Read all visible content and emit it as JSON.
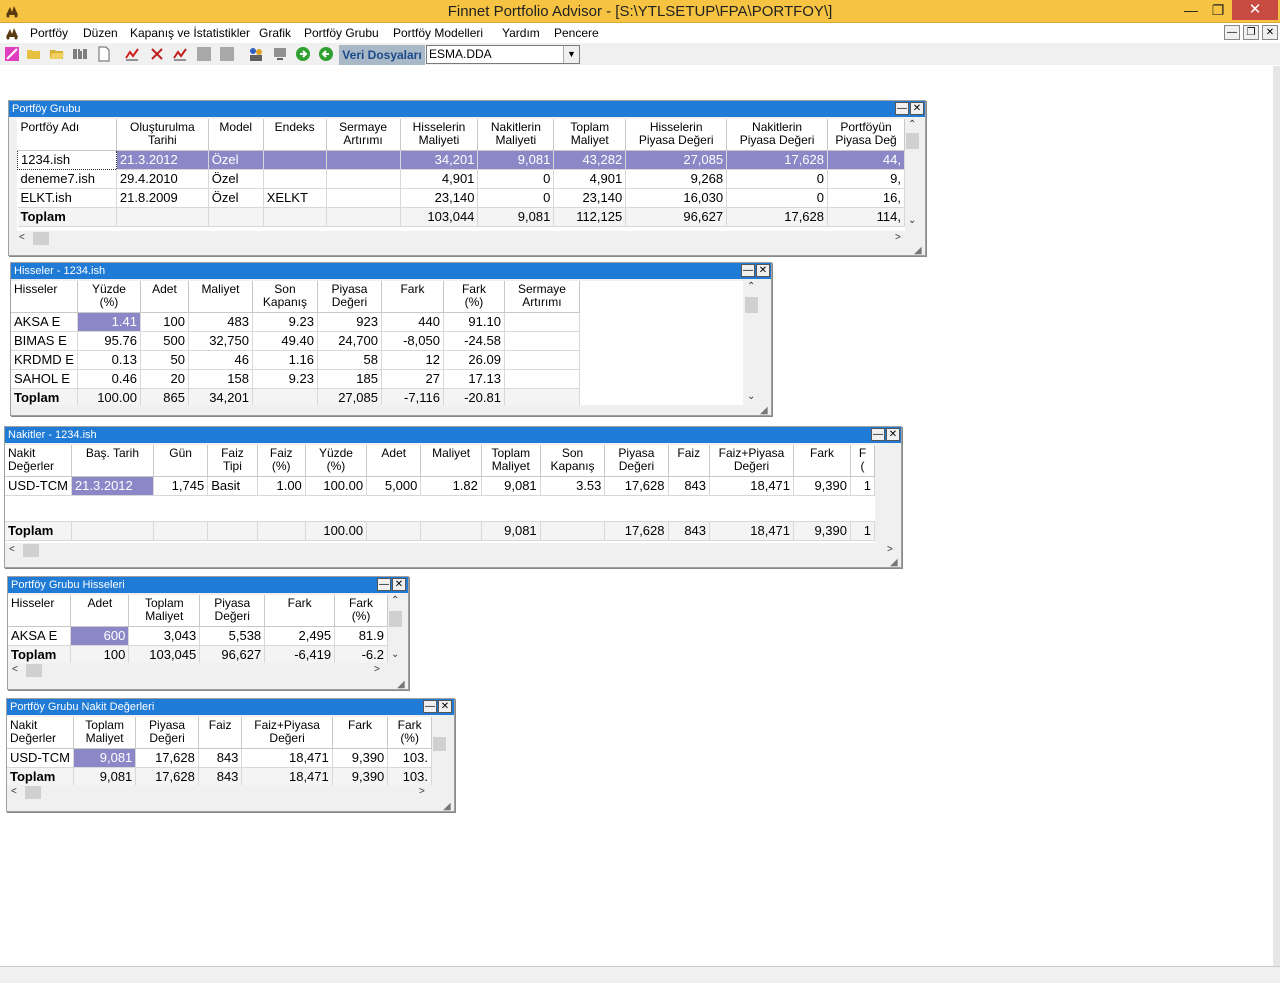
{
  "app": {
    "title": "Finnet Portfolio Advisor - [S:\\YTLSETUP\\FPA\\PORTFOY\\]"
  },
  "menu": [
    "Portföy",
    "Düzen",
    "Kapanış ve İstatistikler",
    "Grafik",
    "Portföy Grubu",
    "Portföy Modelleri",
    "Yardım",
    "Pencere"
  ],
  "toolbar": {
    "veri_label": "Veri Dosyaları",
    "file_value": "ESMA.DDA"
  },
  "portfoy_grubu": {
    "title": "Portföy Grubu",
    "headers": [
      "Portföy Adı",
      "Oluşturulma\nTarihi",
      "Model",
      "Endeks",
      "Sermaye\nArtırımı",
      "Hisselerin\nMaliyeti",
      "Nakitlerin\nMaliyeti",
      "Toplam\nMaliyet",
      "Hisselerin\nPiyasa Değeri",
      "Nakitlerin\nPiyasa Değeri",
      "Portföyün\nPiyasa Değ"
    ],
    "rows": [
      [
        "1234.ish",
        "21.3.2012",
        "Özel",
        "",
        "",
        "34,201",
        "9,081",
        "43,282",
        "27,085",
        "17,628",
        "44,"
      ],
      [
        "deneme7.ish",
        "29.4.2010",
        "Özel",
        "",
        "",
        "4,901",
        "0",
        "4,901",
        "9,268",
        "0",
        "9,"
      ],
      [
        "ELKT.ish",
        "21.8.2009",
        "Özel",
        "XELKT",
        "",
        "23,140",
        "0",
        "23,140",
        "16,030",
        "0",
        "16,"
      ]
    ],
    "total": [
      "Toplam",
      "",
      "",
      "",
      "",
      "103,044",
      "9,081",
      "112,125",
      "96,627",
      "17,628",
      "114,"
    ]
  },
  "hisseler": {
    "title": "Hisseler - 1234.ish",
    "headers": [
      "Hisseler",
      "Yüzde\n(%)",
      "Adet",
      "Maliyet",
      "Son\nKapanış",
      "Piyasa\nDeğeri",
      "Fark",
      "Fark\n(%)",
      "Sermaye\nArtırımı"
    ],
    "rows": [
      [
        "AKSA  E",
        "1.41",
        "100",
        "483",
        "9.23",
        "923",
        "440",
        "91.10",
        ""
      ],
      [
        "BIMAS E",
        "95.76",
        "500",
        "32,750",
        "49.40",
        "24,700",
        "-8,050",
        "-24.58",
        ""
      ],
      [
        "KRDMD E",
        "0.13",
        "50",
        "46",
        "1.16",
        "58",
        "12",
        "26.09",
        ""
      ],
      [
        "SAHOL E",
        "0.46",
        "20",
        "158",
        "9.23",
        "185",
        "27",
        "17.13",
        ""
      ]
    ],
    "total": [
      "Toplam",
      "100.00",
      "865",
      "34,201",
      "",
      "27,085",
      "-7,116",
      "-20.81",
      ""
    ]
  },
  "nakitler": {
    "title": "Nakitler - 1234.ish",
    "headers": [
      "Nakit\nDeğerler",
      "Baş. Tarih",
      "Gün",
      "Faiz\nTipi",
      "Faiz\n(%)",
      "Yüzde\n(%)",
      "Adet",
      "Maliyet",
      "Toplam\nMaliyet",
      "Son\nKapanış",
      "Piyasa\nDeğeri",
      "Faiz",
      "Faiz+Piyasa\nDeğeri",
      "Fark",
      "F\n("
    ],
    "rows": [
      [
        "USD-TCM",
        "21.3.2012",
        "1,745",
        "Basit",
        "1.00",
        "100.00",
        "5,000",
        "1.82",
        "9,081",
        "3.53",
        "17,628",
        "843",
        "18,471",
        "9,390",
        "1"
      ]
    ],
    "total": [
      "Toplam",
      "",
      "",
      "",
      "",
      "100.00",
      "",
      "",
      "9,081",
      "",
      "17,628",
      "843",
      "18,471",
      "9,390",
      "1"
    ]
  },
  "grup_hisseleri": {
    "title": "Portföy Grubu Hisseleri",
    "headers": [
      "Hisseler",
      "Adet",
      "Toplam\nMaliyet",
      "Piyasa\nDeğeri",
      "Fark",
      "Fark\n(%)"
    ],
    "rows": [
      [
        "AKSA  E",
        "600",
        "3,043",
        "5,538",
        "2,495",
        "81.9"
      ]
    ],
    "total": [
      "Toplam",
      "100",
      "103,045",
      "96,627",
      "-6,419",
      "-6.2"
    ]
  },
  "grup_nakit": {
    "title": "Portföy Grubu Nakit Değerleri",
    "headers": [
      "Nakit\nDeğerler",
      "Toplam\nMaliyet",
      "Piyasa\nDeğeri",
      "Faiz",
      "Faiz+Piyasa\nDeğeri",
      "Fark",
      "Fark\n(%)"
    ],
    "rows": [
      [
        "USD-TCM",
        "9,081",
        "17,628",
        "843",
        "18,471",
        "9,390",
        "103."
      ]
    ],
    "total": [
      "Toplam",
      "9,081",
      "17,628",
      "843",
      "18,471",
      "9,390",
      "103."
    ]
  }
}
